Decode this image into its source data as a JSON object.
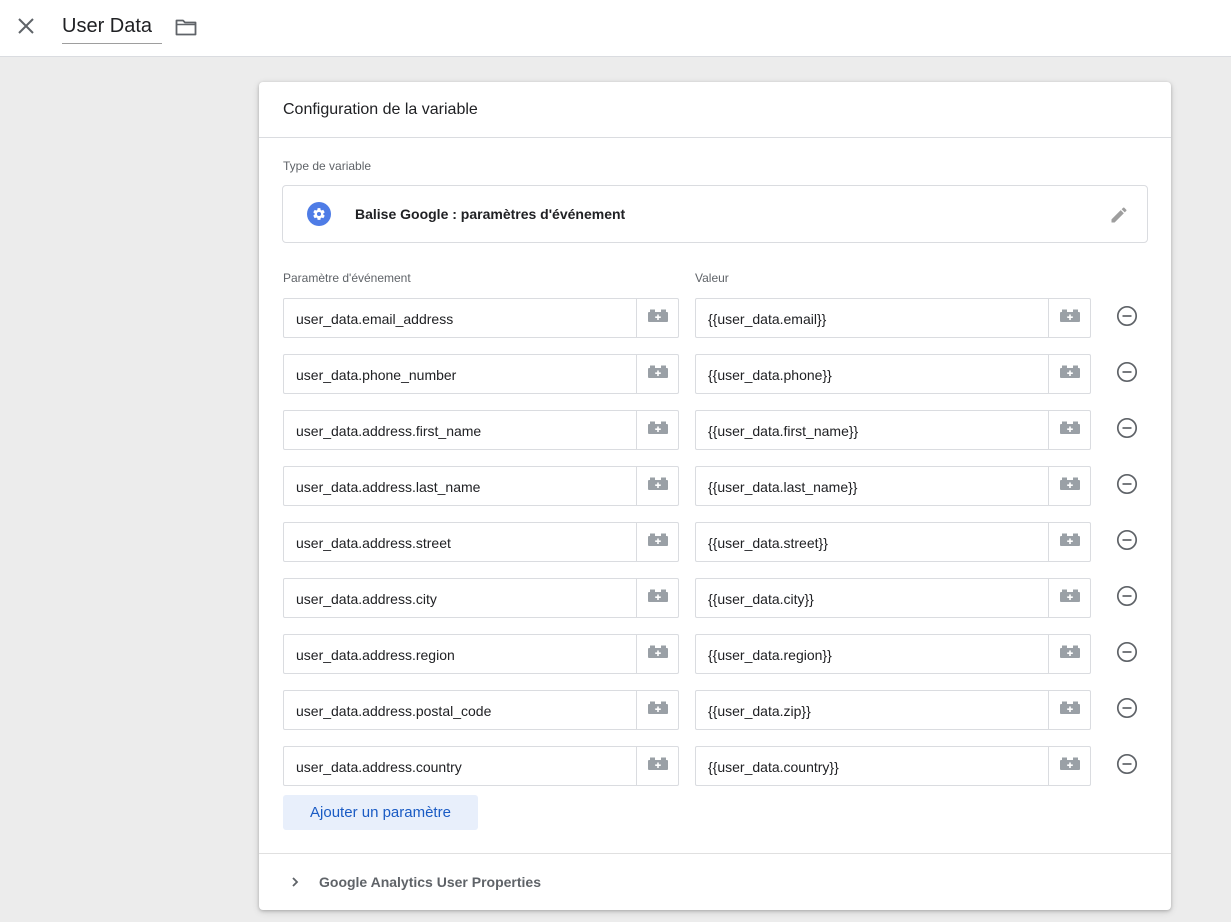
{
  "header": {
    "title": "User Data",
    "close_icon": "close-icon",
    "folder_icon": "folder-icon"
  },
  "card": {
    "title": "Configuration de la variable",
    "type_label": "Type de variable",
    "type_name": "Balise Google : paramètres d'événement",
    "type_icon": "gear-icon",
    "param_col_label": "Paramètre d'événement",
    "value_col_label": "Valeur",
    "rows": [
      {
        "param": "user_data.email_address",
        "value": "{{user_data.email}}"
      },
      {
        "param": "user_data.phone_number",
        "value": "{{user_data.phone}}"
      },
      {
        "param": "user_data.address.first_name",
        "value": "{{user_data.first_name}}"
      },
      {
        "param": "user_data.address.last_name",
        "value": "{{user_data.last_name}}"
      },
      {
        "param": "user_data.address.street",
        "value": "{{user_data.street}}"
      },
      {
        "param": "user_data.address.city",
        "value": "{{user_data.city}}"
      },
      {
        "param": "user_data.address.region",
        "value": "{{user_data.region}}"
      },
      {
        "param": "user_data.address.postal_code",
        "value": "{{user_data.zip}}"
      },
      {
        "param": "user_data.address.country",
        "value": "{{user_data.country}}"
      }
    ],
    "add_button_label": "Ajouter un paramètre",
    "expander_label": "Google Analytics User Properties"
  },
  "colors": {
    "accent": "#1a5bc4",
    "type_icon_bg": "#4e7ce6",
    "add_button_bg": "#e8effb"
  }
}
